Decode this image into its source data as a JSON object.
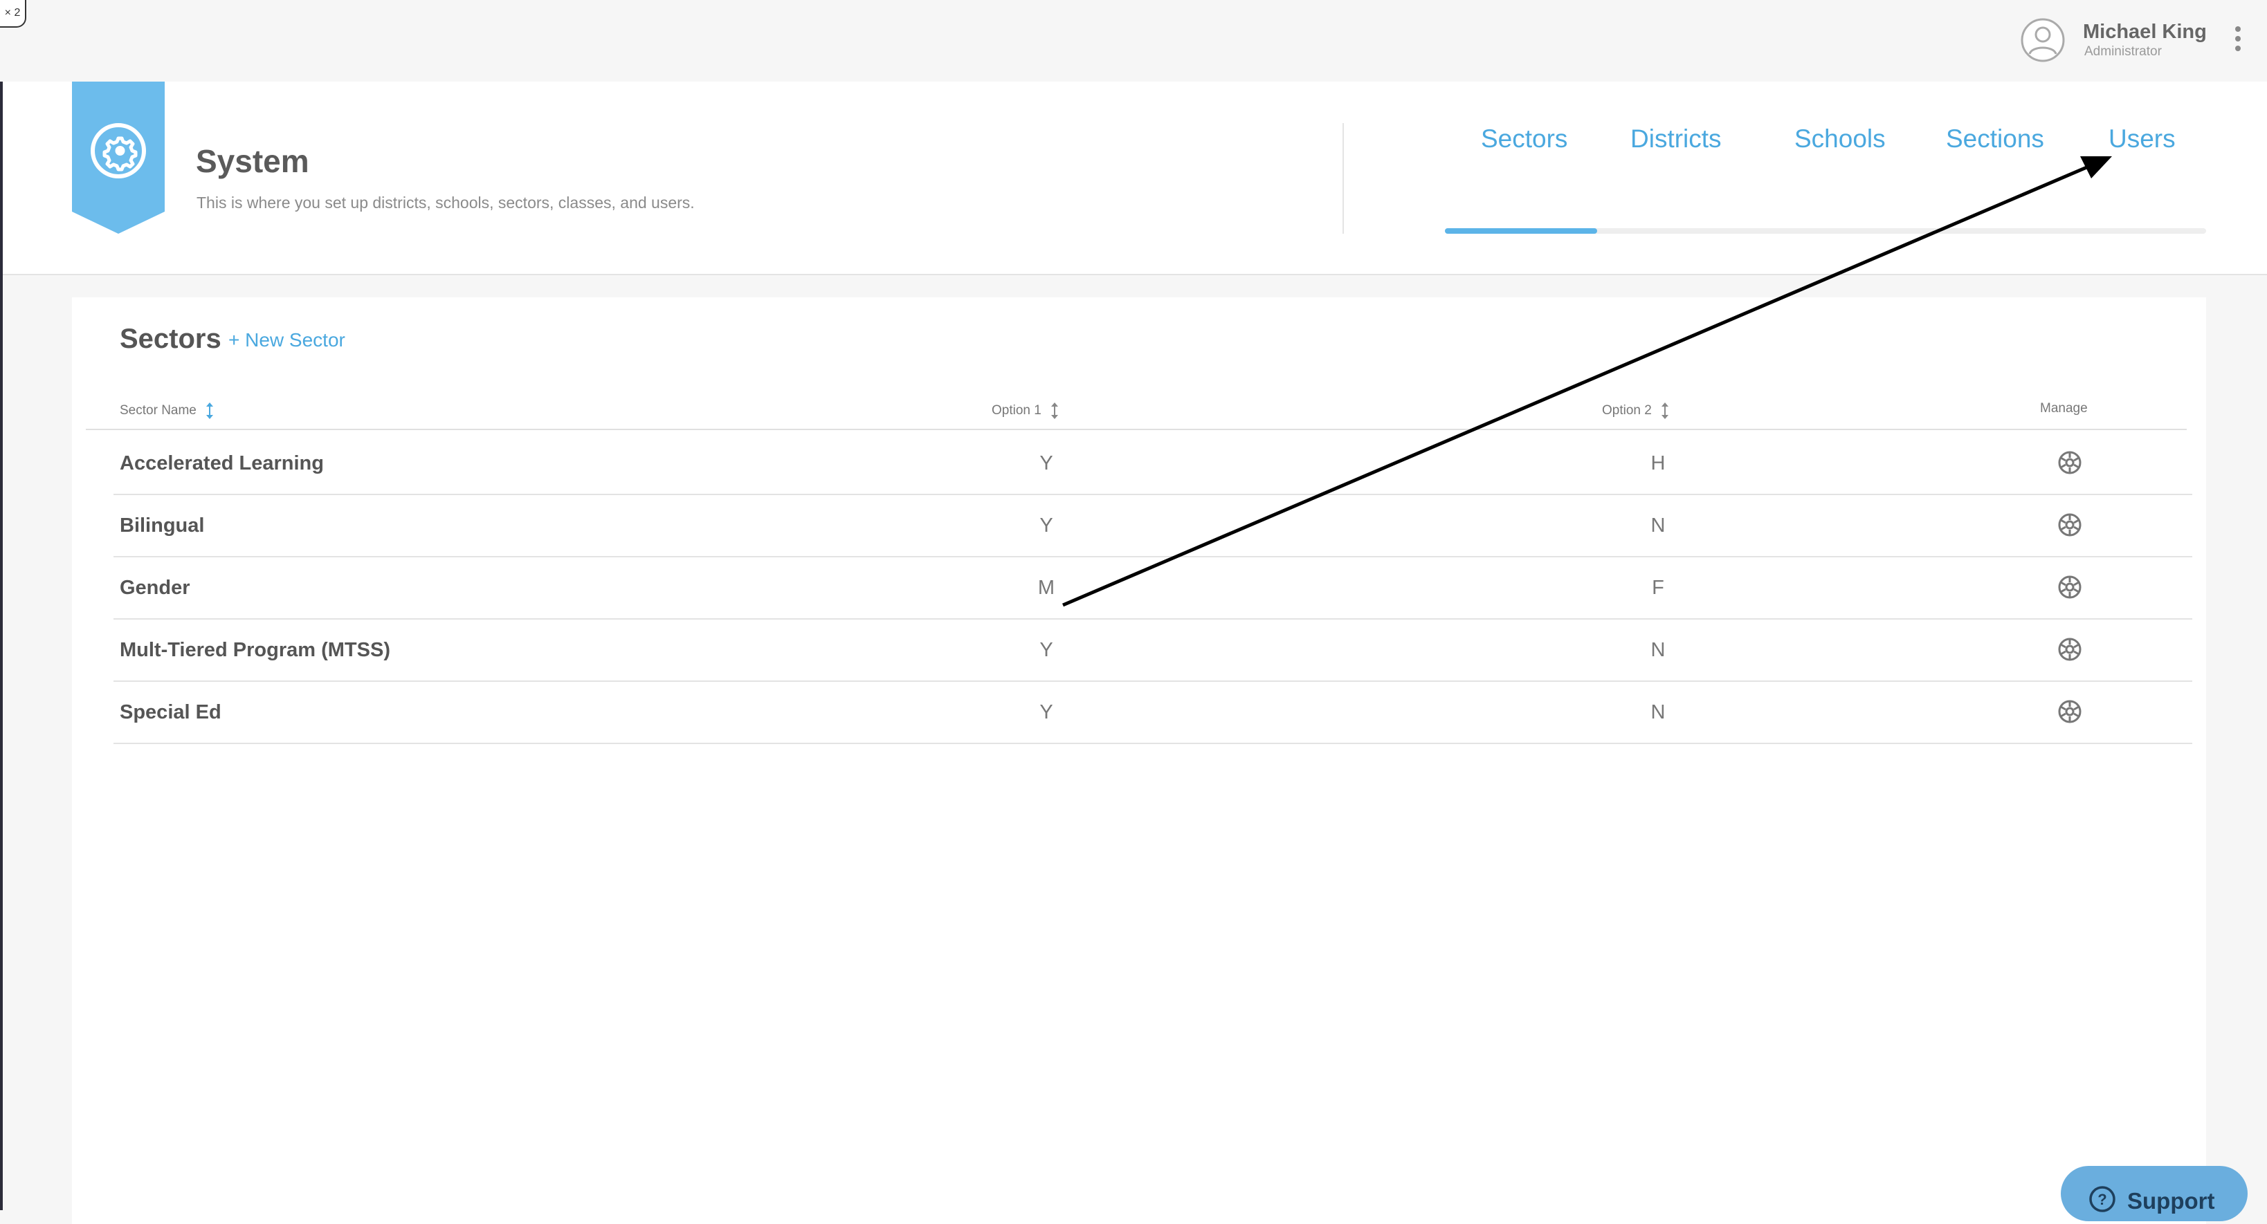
{
  "window": {
    "zoom_badge": "× 2"
  },
  "user": {
    "name": "Michael King",
    "role": "Administrator"
  },
  "header": {
    "title": "System",
    "subtitle": "This is where you set up districts, schools, sectors, classes, and users."
  },
  "tabs": [
    {
      "label": "Sectors",
      "active": true
    },
    {
      "label": "Districts",
      "active": false
    },
    {
      "label": "Schools",
      "active": false
    },
    {
      "label": "Sections",
      "active": false
    },
    {
      "label": "Users",
      "active": false
    }
  ],
  "sectors": {
    "title": "Sectors",
    "new_label": "+ New Sector",
    "columns": {
      "name": "Sector Name",
      "option1": "Option 1",
      "option2": "Option 2",
      "manage": "Manage"
    },
    "rows": [
      {
        "name": "Accelerated Learning",
        "option1": "Y",
        "option2": "H"
      },
      {
        "name": "Bilingual",
        "option1": "Y",
        "option2": "N"
      },
      {
        "name": "Gender",
        "option1": "M",
        "option2": "F"
      },
      {
        "name": "Mult-Tiered Program (MTSS)",
        "option1": "Y",
        "option2": "N"
      },
      {
        "name": "Special Ed",
        "option1": "Y",
        "option2": "N"
      }
    ]
  },
  "support": {
    "label": "Support"
  },
  "colors": {
    "accent": "#4aa8df",
    "banner": "#6cbcec",
    "support": "#6aaede"
  },
  "icons": {
    "banner": "gear-badge-icon",
    "manage": "gear-icon",
    "sort": "sort-arrows-icon",
    "user": "user-avatar-icon",
    "menu": "kebab-menu-icon",
    "support": "question-circle-icon"
  }
}
